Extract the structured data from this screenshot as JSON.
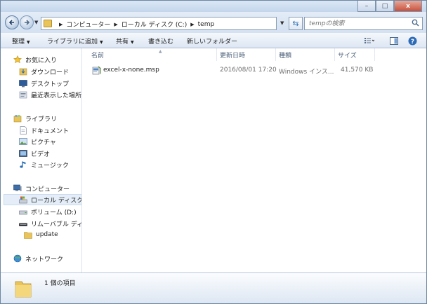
{
  "window": {
    "title": "",
    "buttons": {
      "minimize": "–",
      "maximize": "□",
      "close": "x"
    }
  },
  "address": {
    "crumbs": [
      "コンピューター",
      "ローカル ディスク (C:)",
      "temp"
    ],
    "search_placeholder": "tempの検索"
  },
  "toolbar": {
    "organize": "整理",
    "add_to_library": "ライブラリに追加",
    "share": "共有",
    "burn": "書き込む",
    "new_folder": "新しいフォルダー"
  },
  "nav": {
    "favorites": "お気に入り",
    "downloads": "ダウンロード",
    "desktop": "デスクトップ",
    "recent": "最近表示した場所",
    "libraries": "ライブラリ",
    "documents": "ドキュメント",
    "pictures": "ピクチャ",
    "videos": "ビデオ",
    "music": "ミュージック",
    "computer": "コンピューター",
    "local_disk": "ローカル ディスク (C:)",
    "volume_d": "ボリューム (D:)",
    "removable": "リムーバブル ディスク",
    "update": "update",
    "network": "ネットワーク"
  },
  "columns": {
    "name": "名前",
    "modified": "更新日時",
    "type": "種類",
    "size": "サイズ"
  },
  "files": [
    {
      "name": "excel-x-none.msp",
      "modified": "2016/08/01 17:20",
      "type": "Windows インス...",
      "size": "41,570 KB"
    }
  ],
  "status": {
    "count": "1 個の項目"
  },
  "colors": {
    "accent": "#2c6fb6",
    "folder": "#e9c45a",
    "selection": "#e5eef8"
  }
}
